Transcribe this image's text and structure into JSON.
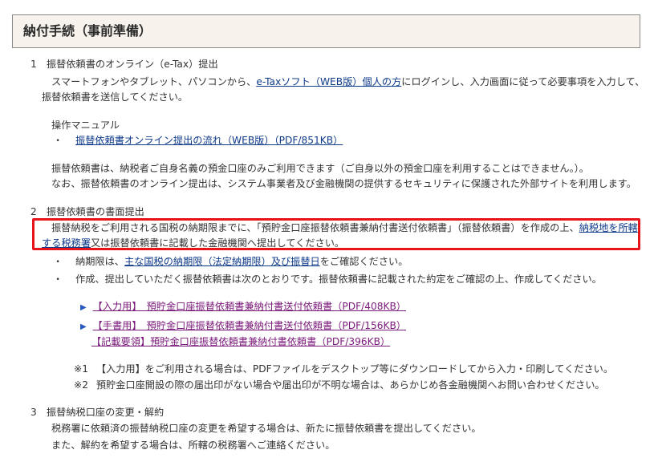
{
  "header": {
    "title": "納付手続（事前準備）"
  },
  "section1": {
    "heading": "1　振替依頼書のオンライン（e-Tax）提出",
    "para_pre": "スマートフォンやタブレット、パソコンから、",
    "para_link": "e-Taxソフト（WEB版）個人の方",
    "para_post": "にログインし、入力画面に従って必要事項を入力して、",
    "para_line2": "振替依頼書を送信してください。",
    "manual_label": "操作マニュアル",
    "manual_bullet": "・",
    "manual_link": "振替依頼書オンライン提出の流れ（WEB版）（PDF/851KB）",
    "note1": "振替依頼書は、納税者ご自身名義の預金口座のみご利用できます（ご自身以外の預金口座を利用することはできません。）。",
    "note2": "なお、振替依頼書のオンライン提出は、システム事業者及び金融機関の提供するセキュリティに保護された外部サイトを利用します。"
  },
  "section2": {
    "heading": "2　振替依頼書の書面提出",
    "hl_line1_pre": "振替納税をご利用される国税の納期限までに、「預貯金口座振替依頼書兼納付書送付依頼書」（振替依頼書）を作成の上、",
    "hl_line1_link": "納税地を所轄",
    "hl_line2_link": "する税務署",
    "hl_line2_post": "又は振替依頼書に記載した金融機関へ提出してください。",
    "bullet1_pre": "納期限は、",
    "bullet1_link": "主な国税の納期限（法定納期限）及び振替日",
    "bullet1_post": "をご確認ください。",
    "bullet2": "作成、提出していただく振替依頼書は次のとおりです。振替依頼書に記載された約定をご確認の上、作成してください。",
    "bullet_mark": "・",
    "doc1_link": "【入力用】　預貯金口座振替依頼書兼納付書送付依頼書（PDF/408KB）",
    "doc2_link": "【手書用】　預貯金口座振替依頼書兼納付書送付依頼書（PDF/156KB）",
    "doc3_link": "【記載要領】預貯金口座振替依頼書兼納付書依頼書（PDF/396KB）",
    "tri_mark": "▶",
    "fn1_mark": "※1",
    "fn1_text": "【入力用】をご利用される場合は、PDFファイルをデスクトップ等にダウンロードしてから入力・印刷してください。",
    "fn2_mark": "※2",
    "fn2_text": "預貯金口座開設の際の届出印がない場合や届出印が不明な場合は、あらかじめ各金融機関へお問い合わせください。"
  },
  "section3": {
    "heading": "3　振替納税口座の変更・解約",
    "line1": "税務署に依頼済の振替納税口座の変更を希望する場合は、新たに振替依頼書を提出してください。",
    "line2": "また、解約を希望する場合は、所轄の税務署へご連絡ください。"
  },
  "colors": {
    "link": "#0e3a8a",
    "visited_link": "#7a1a7a",
    "highlight_border": "#e8141b",
    "header_bg": "#f7f3ec"
  }
}
